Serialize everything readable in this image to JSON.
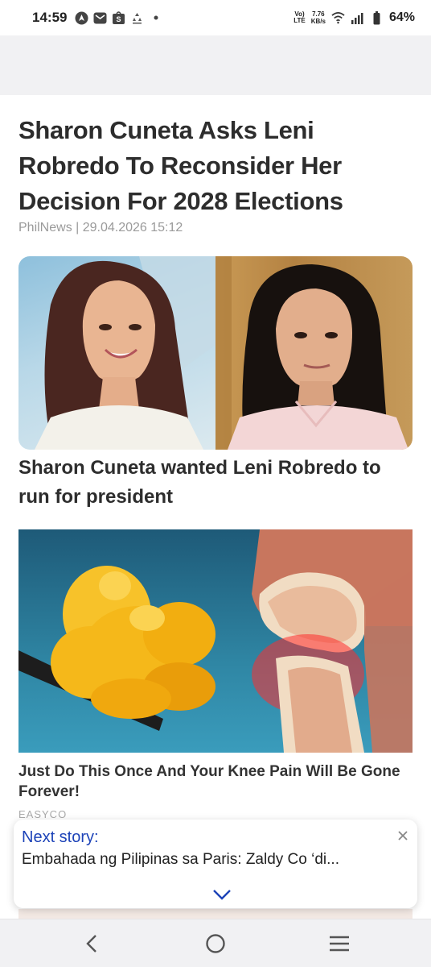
{
  "status_bar": {
    "time": "14:59",
    "network_top": "Vo)",
    "network_bottom": "LTE",
    "speed_value": "7.76",
    "speed_unit": "KB/s",
    "battery": "64%"
  },
  "article": {
    "headline": "Sharon Cuneta Asks Leni Robredo To Reconsider Her Decision For 2028 Elections",
    "byline": "PhilNews | 29.04.2026 15:12",
    "image_caption": "Sharon Cuneta wanted Leni Robredo to run for president"
  },
  "ad": {
    "title": "Just Do This Once And Your Knee Pain Will Be Gone Forever!",
    "source": "EASYCO"
  },
  "next_story": {
    "label": "Next story:",
    "title": "Embahada ng Pilipinas sa Paris: Zaldy Co ‘di..."
  },
  "icons": {
    "status_left": [
      "navigation-icon",
      "mail-icon",
      "shopping-bag-icon",
      "recycle-icon",
      "dot-icon"
    ],
    "status_right": [
      "wifi-icon",
      "signal-icon",
      "battery-icon"
    ],
    "popup": [
      "close-icon",
      "chevron-down-icon"
    ],
    "nav": [
      "back-icon",
      "home-icon",
      "recents-icon"
    ]
  },
  "colors": {
    "accent": "#1d43b8",
    "headline": "#2d2d2d",
    "byline": "#9a9a9a"
  }
}
